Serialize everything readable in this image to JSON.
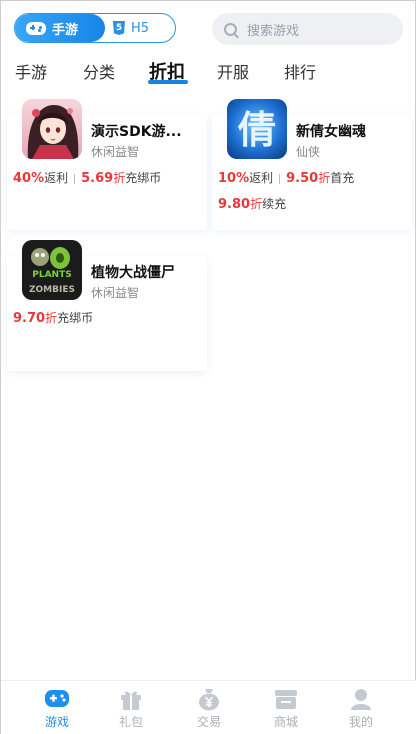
{
  "header": {
    "segment": {
      "active_label": "手游",
      "inactive_label": "H5",
      "h5_badge": "5"
    },
    "search": {
      "placeholder": "搜索游戏"
    }
  },
  "tabs": [
    {
      "label": "手游"
    },
    {
      "label": "分类"
    },
    {
      "label": "折扣"
    },
    {
      "label": "开服"
    },
    {
      "label": "排行"
    }
  ],
  "games": [
    {
      "name": "演示SDK游...",
      "tag": "休闲益智",
      "lines": [
        {
          "parts": [
            {
              "v": "40%"
            },
            {
              "t": "返利"
            },
            {
              "sep": true
            },
            {
              "v": "5.69"
            },
            {
              "u": "折"
            },
            {
              "t": "充绑币"
            }
          ]
        }
      ]
    },
    {
      "name": "新倩女幽魂",
      "tag": "仙侠",
      "lines": [
        {
          "parts": [
            {
              "v": "10%"
            },
            {
              "t": "返利"
            },
            {
              "sep": true
            },
            {
              "v": "9.50"
            },
            {
              "u": "折"
            },
            {
              "t": "首充"
            }
          ]
        },
        {
          "parts": [
            {
              "v": "9.80"
            },
            {
              "u": "折"
            },
            {
              "t": "续充"
            }
          ]
        }
      ]
    },
    {
      "name": "植物大战僵尸",
      "tag": "休闲益智",
      "lines": [
        {
          "parts": [
            {
              "v": "9.70"
            },
            {
              "u": "折"
            },
            {
              "t": "充绑币"
            }
          ]
        }
      ]
    }
  ],
  "game_icons": [
    "anime-girl-game-icon",
    "qian-calligraphy-game-icon",
    "plants-vs-zombies-game-icon"
  ],
  "game_icon_text": {
    "pvz_line1": "PLANTS",
    "pvz_line2": "ZOMBIES",
    "qian_char": "倩"
  },
  "bottom_nav": [
    {
      "label": "游戏",
      "icon": "gamepad-icon"
    },
    {
      "label": "礼包",
      "icon": "gift-icon"
    },
    {
      "label": "交易",
      "icon": "yen-bag-icon"
    },
    {
      "label": "商城",
      "icon": "store-icon"
    },
    {
      "label": "我的",
      "icon": "user-icon"
    }
  ],
  "colors": {
    "accent": "#1684e8",
    "discount_red": "#e43a3a"
  }
}
